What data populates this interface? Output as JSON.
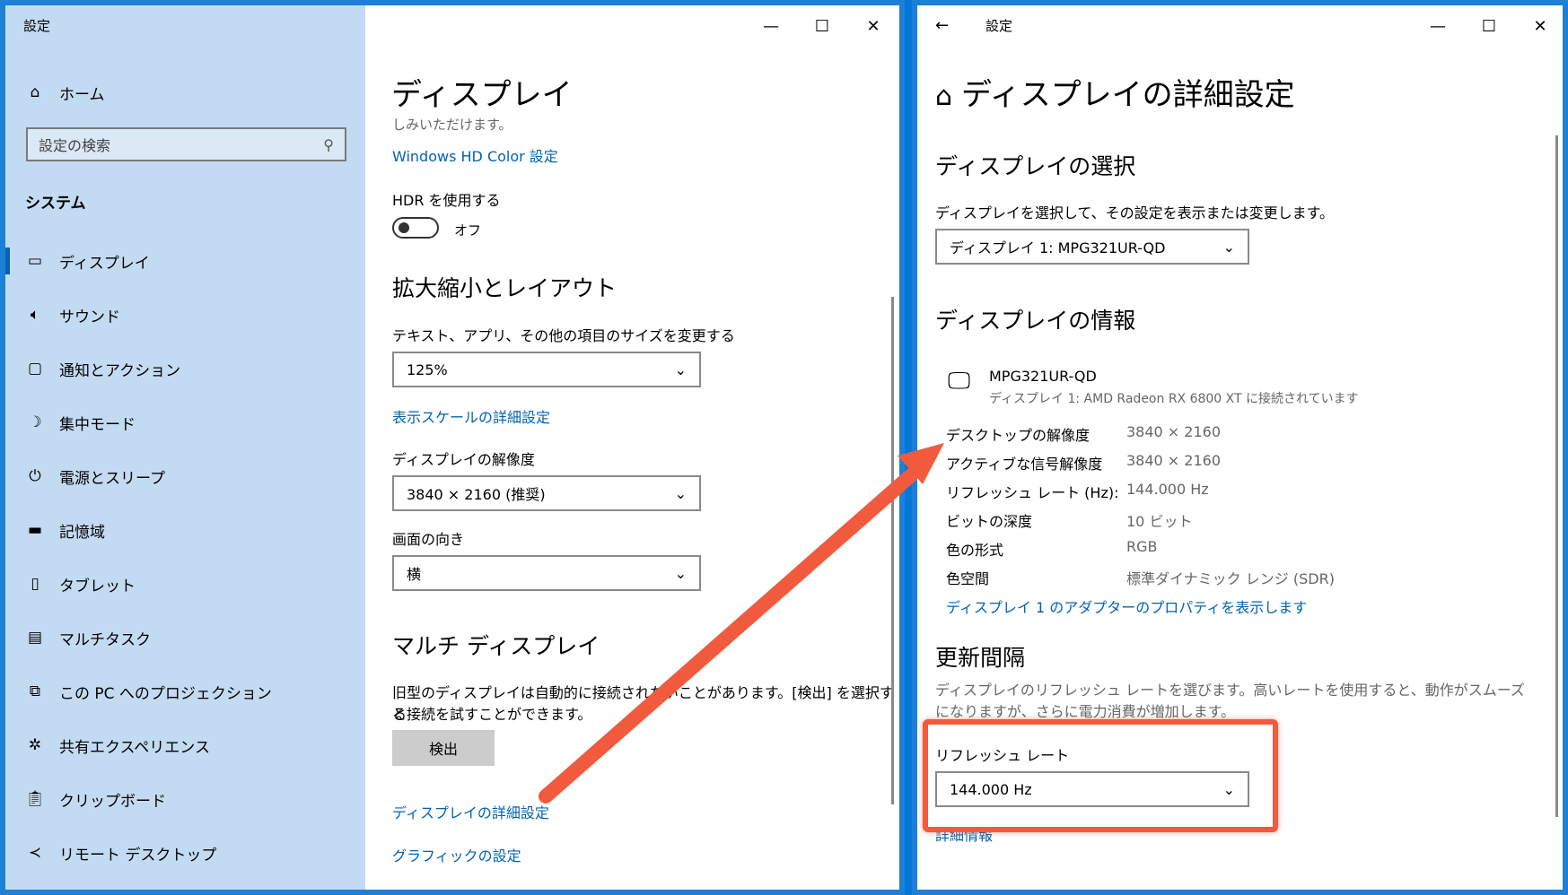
{
  "left_window": {
    "title": "設定",
    "caption": {
      "minimize": "—",
      "maximize": "☐",
      "close": "✕"
    },
    "sidebar": {
      "home_label": "ホーム",
      "search_placeholder": "設定の検索",
      "section_title": "システム",
      "items": [
        {
          "label": "ディスプレイ",
          "icon": "monitor-icon"
        },
        {
          "label": "サウンド",
          "icon": "speaker-icon"
        },
        {
          "label": "通知とアクション",
          "icon": "notification-icon"
        },
        {
          "label": "集中モード",
          "icon": "moon-icon"
        },
        {
          "label": "電源とスリープ",
          "icon": "power-icon"
        },
        {
          "label": "記憶域",
          "icon": "storage-icon"
        },
        {
          "label": "タブレット",
          "icon": "tablet-icon"
        },
        {
          "label": "マルチタスク",
          "icon": "multitask-icon"
        },
        {
          "label": "この PC へのプロジェクション",
          "icon": "projection-icon"
        },
        {
          "label": "共有エクスペリエンス",
          "icon": "share-icon"
        },
        {
          "label": "クリップボード",
          "icon": "clipboard-icon"
        },
        {
          "label": "リモート デスクトップ",
          "icon": "remote-desktop-icon"
        }
      ]
    },
    "main": {
      "page_title": "ディスプレイ",
      "truncated_text": "しみいただけます。",
      "hd_color_link": "Windows HD Color 設定",
      "hdr_label": "HDR を使用する",
      "hdr_state": "オフ",
      "scale_heading": "拡大縮小とレイアウト",
      "size_label": "テキスト、アプリ、その他の項目のサイズを変更する",
      "size_value": "125%",
      "scale_link": "表示スケールの詳細設定",
      "resolution_label": "ディスプレイの解像度",
      "resolution_value": "3840 × 2160 (推奨)",
      "orientation_label": "画面の向き",
      "orientation_value": "横",
      "multi_heading": "マルチ ディスプレイ",
      "multi_desc_1": "旧型のディスプレイは自動的に接続されないことがあります。[検出] を選択する",
      "multi_desc_2": "と接続を試すことができます。",
      "detect_button": "検出",
      "advanced_link": "ディスプレイの詳細設定",
      "graphics_link": "グラフィックの設定"
    }
  },
  "right_window": {
    "title": "設定",
    "caption": {
      "minimize": "—",
      "maximize": "☐",
      "close": "✕"
    },
    "page_title": "ディスプレイの詳細設定",
    "select_heading": "ディスプレイの選択",
    "select_desc": "ディスプレイを選択して、その設定を表示または変更します。",
    "select_value": "ディスプレイ 1: MPG321UR-QD",
    "info_heading": "ディスプレイの情報",
    "monitor_name": "MPG321UR-QD",
    "monitor_sub": "ディスプレイ 1: AMD Radeon RX 6800 XT に接続されています",
    "info_rows": [
      {
        "label": "デスクトップの解像度",
        "value": "3840 × 2160"
      },
      {
        "label": "アクティブな信号解像度",
        "value": "3840 × 2160"
      },
      {
        "label": "リフレッシュ レート (Hz):",
        "value": "144.000 Hz"
      },
      {
        "label": "ビットの深度",
        "value": "10 ビット"
      },
      {
        "label": "色の形式",
        "value": "RGB"
      },
      {
        "label": "色空間",
        "value": "標準ダイナミック レンジ (SDR)"
      }
    ],
    "adapter_link": "ディスプレイ 1 のアダプターのプロパティを表示します",
    "refresh_heading": "更新間隔",
    "refresh_desc_1": "ディスプレイのリフレッシュ レートを選びます。高いレートを使用すると、動作がスムーズ",
    "refresh_desc_2": "になりますが、さらに電力消費が増加します。",
    "refresh_label": "リフレッシュ レート",
    "refresh_value": "144.000 Hz",
    "details_link": "詳細情報"
  },
  "colors": {
    "accent": "#0063b1",
    "sidebar": "#c3dbf2",
    "annotation": "#f25a3d"
  }
}
